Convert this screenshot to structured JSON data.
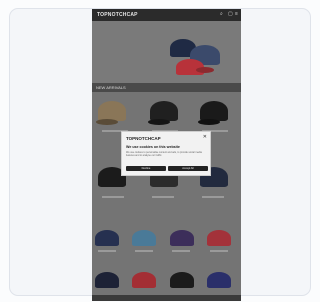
{
  "store": {
    "logo_text": "TOPNOTCHCAP",
    "section_title": "NEW ARRIVALS"
  },
  "cookie_modal": {
    "logo_text": "TOPNOTCHCAP",
    "close_icon": "close-icon",
    "title": "We use cookies on this website",
    "body": "We use cookies to personalise content and ads, to provide social media features and to analyse our traffic.",
    "decline_label": "Decline",
    "accept_label": "Accept All"
  },
  "icons": {
    "search": "search-icon",
    "cart": "cart-icon",
    "menu": "menu-icon"
  },
  "colors": {
    "overlay": "#6e6e6e",
    "modal_bg": "#f2f2f2",
    "button": "#222222"
  }
}
